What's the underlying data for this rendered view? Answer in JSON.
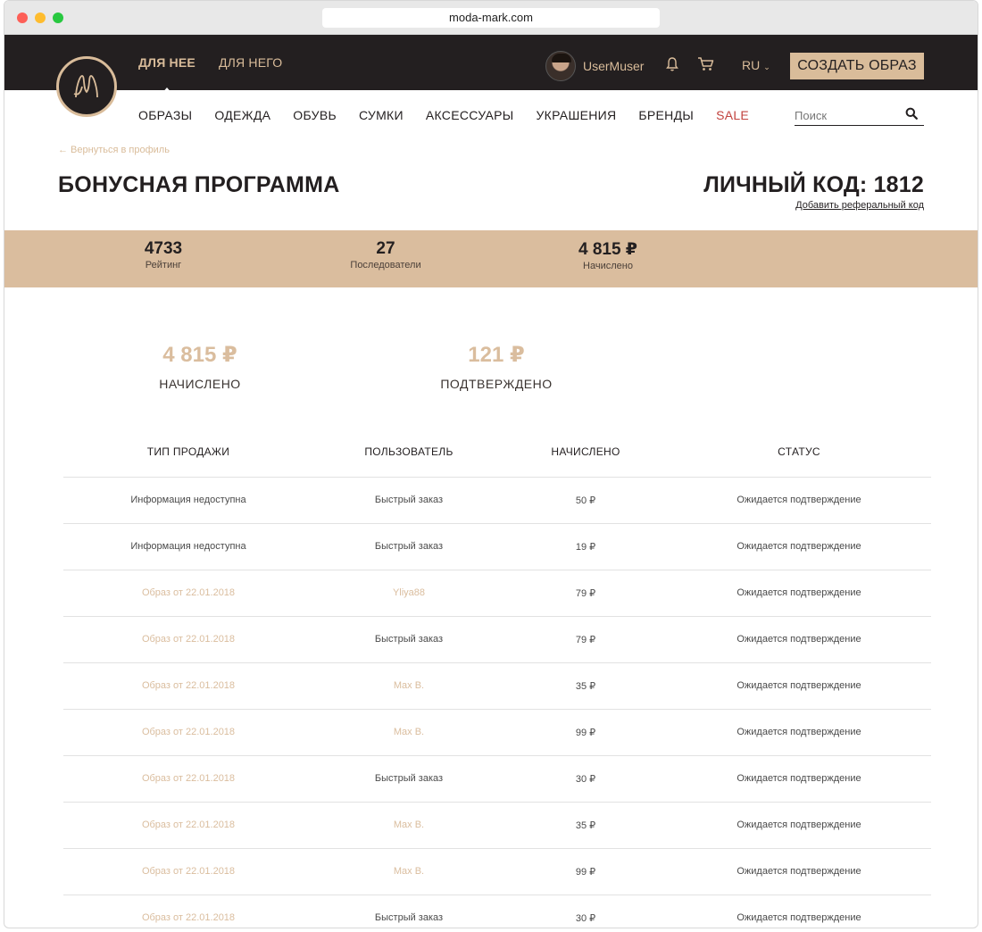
{
  "browser": {
    "url": "moda-mark.com"
  },
  "header": {
    "top_nav": [
      {
        "label": "ДЛЯ НЕЕ"
      },
      {
        "label": "ДЛЯ НЕГО"
      }
    ],
    "username": "UserMuser",
    "lang": "RU",
    "create_button": "СОЗДАТЬ ОБРАЗ",
    "categories": [
      "ОБРАЗЫ",
      "ОДЕЖДА",
      "ОБУВЬ",
      "СУМКИ",
      "АКСЕССУАРЫ",
      "УКРАШЕНИЯ",
      "БРЕНДЫ",
      "SALE"
    ],
    "search_placeholder": "Поиск"
  },
  "page": {
    "back_link": "← Вернуться в профиль",
    "title": "БОНУСНАЯ ПРОГРАММА",
    "personal_code": "ЛИЧНЫЙ КОД: 1812",
    "referral_link": "Добавить реферальный код"
  },
  "stats": [
    {
      "value": "4733",
      "label": "Рейтинг"
    },
    {
      "value": "27",
      "label": "Последователи"
    },
    {
      "value": "4 815 ₽",
      "label": "Начислено"
    }
  ],
  "summary": [
    {
      "value": "4 815 ₽",
      "label": "НАЧИСЛЕНО"
    },
    {
      "value": "121 ₽",
      "label": "ПОДТВЕРЖДЕНО"
    }
  ],
  "table": {
    "headers": [
      "ТИП ПРОДАЖИ",
      "ПОЛЬЗОВАТЕЛЬ",
      "НАЧИСЛЕНО",
      "СТАТУС"
    ],
    "rows": [
      {
        "type": "Информация недоступна",
        "user": "Быстрый заказ",
        "amount": "50 ₽",
        "status": "Ожидается подтверждение"
      },
      {
        "type": "Информация недоступна",
        "user": "Быстрый заказ",
        "amount": "19 ₽",
        "status": "Ожидается подтверждение"
      },
      {
        "type": "Образ от 22.01.2018",
        "user": "Yliya88",
        "amount": "79 ₽",
        "status": "Ожидается подтверждение"
      },
      {
        "type": "Образ от 22.01.2018",
        "user": "Быстрый заказ",
        "amount": "79 ₽",
        "status": "Ожидается подтверждение"
      },
      {
        "type": "Образ от 22.01.2018",
        "user": "Max B.",
        "amount": "35 ₽",
        "status": "Ожидается подтверждение"
      },
      {
        "type": "Образ от 22.01.2018",
        "user": "Max B.",
        "amount": "99 ₽",
        "status": "Ожидается подтверждение"
      },
      {
        "type": "Образ от 22.01.2018",
        "user": "Быстрый заказ",
        "amount": "30 ₽",
        "status": "Ожидается подтверждение"
      },
      {
        "type": "Образ от 22.01.2018",
        "user": "Max B.",
        "amount": "35 ₽",
        "status": "Ожидается подтверждение"
      },
      {
        "type": "Образ от 22.01.2018",
        "user": "Max B.",
        "amount": "99 ₽",
        "status": "Ожидается подтверждение"
      },
      {
        "type": "Образ от 22.01.2018",
        "user": "Быстрый заказ",
        "amount": "30 ₽",
        "status": "Ожидается подтверждение"
      }
    ]
  },
  "colors": {
    "accent": "#dabd9e",
    "dark": "#231f20",
    "sale": "#c2433f"
  },
  "icons": [
    "logo-icon",
    "bell-icon",
    "cart-icon",
    "chevron-down-icon",
    "search-icon",
    "avatar"
  ]
}
